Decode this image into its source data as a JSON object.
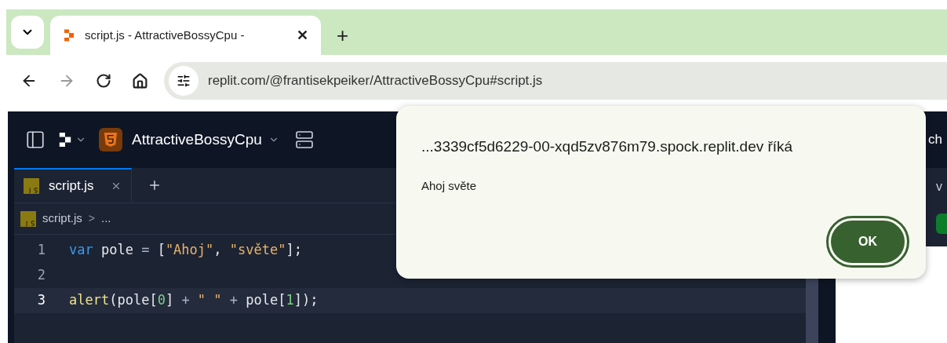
{
  "browser_tab": {
    "title": "script.js - AttractiveBossyCpu - ",
    "close": "✕",
    "new_tab": "+"
  },
  "address_bar": {
    "url": "replit.com/@frantisekpeiker/AttractiveBossyCpu#script.js"
  },
  "replit_header": {
    "project_name": "AttractiveBossyCpu",
    "cut_text": "ch"
  },
  "editor_tabs": [
    {
      "label": "script.js",
      "selected": true
    }
  ],
  "breadcrumb": {
    "file": "script.js",
    "separator": ">",
    "rest": "..."
  },
  "code_lines": [
    {
      "number": "1",
      "current": false,
      "tokens": [
        {
          "kind": "keyword",
          "text": "var"
        },
        {
          "kind": "plain",
          "text": " pole "
        },
        {
          "kind": "op",
          "text": "= "
        },
        {
          "kind": "punct",
          "text": "["
        },
        {
          "kind": "string",
          "text": "\"Ahoj\""
        },
        {
          "kind": "punct",
          "text": ", "
        },
        {
          "kind": "string",
          "text": "\"světe\""
        },
        {
          "kind": "punct",
          "text": "];"
        }
      ]
    },
    {
      "number": "2",
      "current": false
    },
    {
      "number": "3",
      "current": true,
      "tokens": [
        {
          "kind": "func",
          "text": "alert"
        },
        {
          "kind": "punct",
          "text": "("
        },
        {
          "kind": "plain",
          "text": "pole"
        },
        {
          "kind": "punct",
          "text": "["
        },
        {
          "kind": "number",
          "text": "0"
        },
        {
          "kind": "punct",
          "text": "] "
        },
        {
          "kind": "op",
          "text": "+ "
        },
        {
          "kind": "string",
          "text": "\" \" "
        },
        {
          "kind": "op",
          "text": "+"
        },
        {
          "kind": "plain",
          "text": " pole"
        },
        {
          "kind": "punct",
          "text": "["
        },
        {
          "kind": "number",
          "text": "1"
        },
        {
          "kind": "punct",
          "text": "]);"
        }
      ]
    }
  ],
  "right_pane": {
    "cut_text": "v"
  },
  "dialog": {
    "title": "...3339cf5d6229-00-xqd5zv876m79.spock.replit.dev říká",
    "message": "Ahoj světe",
    "button": "OK"
  }
}
